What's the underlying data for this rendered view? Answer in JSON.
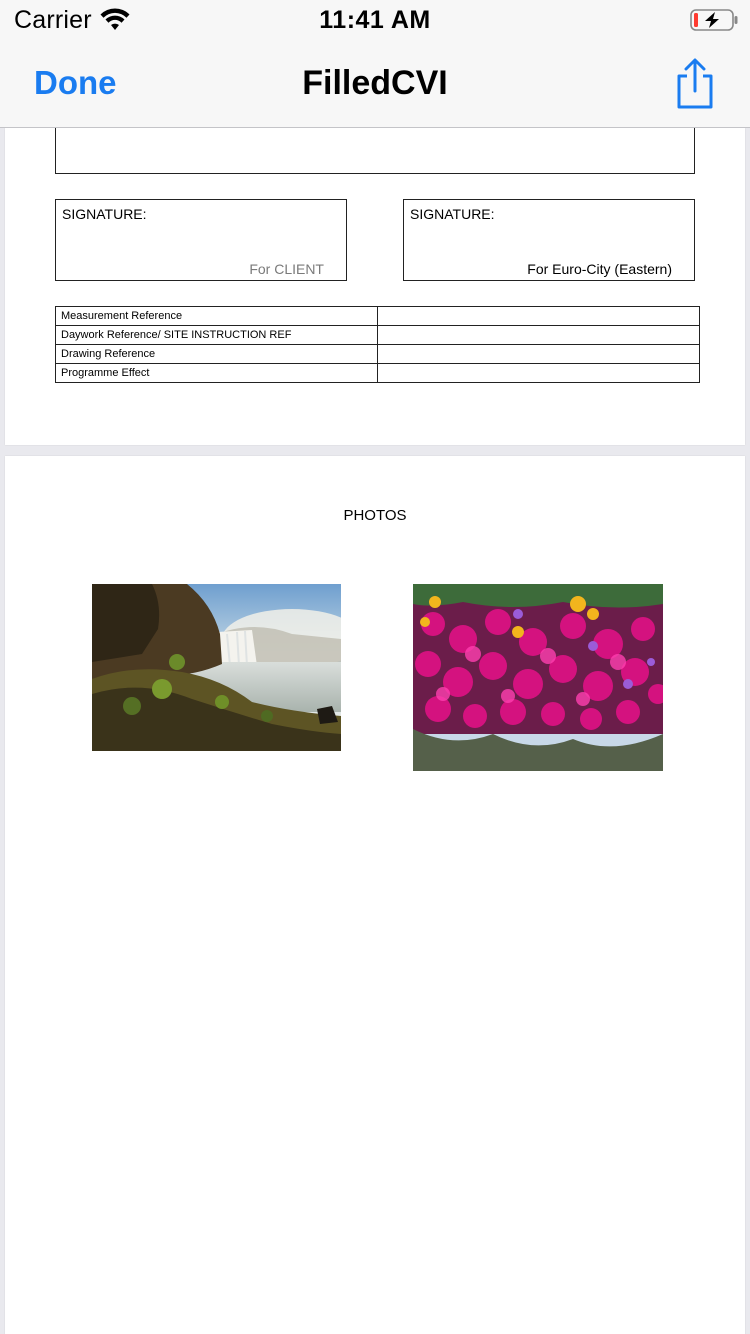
{
  "status_bar": {
    "carrier": "Carrier",
    "time": "11:41 AM"
  },
  "nav_bar": {
    "done_label": "Done",
    "title": "FilledCVI"
  },
  "document": {
    "signatures": [
      {
        "label": "SIGNATURE:",
        "for": "For CLIENT"
      },
      {
        "label": "SIGNATURE:",
        "for": "For Euro-City (Eastern)"
      }
    ],
    "reference_rows": [
      {
        "label": "Measurement Reference",
        "value": ""
      },
      {
        "label": "Daywork Reference/ SITE INSTRUCTION REF",
        "value": ""
      },
      {
        "label": "Drawing Reference",
        "value": ""
      },
      {
        "label": "Programme Effect",
        "value": ""
      }
    ],
    "photos_title": "PHOTOS"
  }
}
